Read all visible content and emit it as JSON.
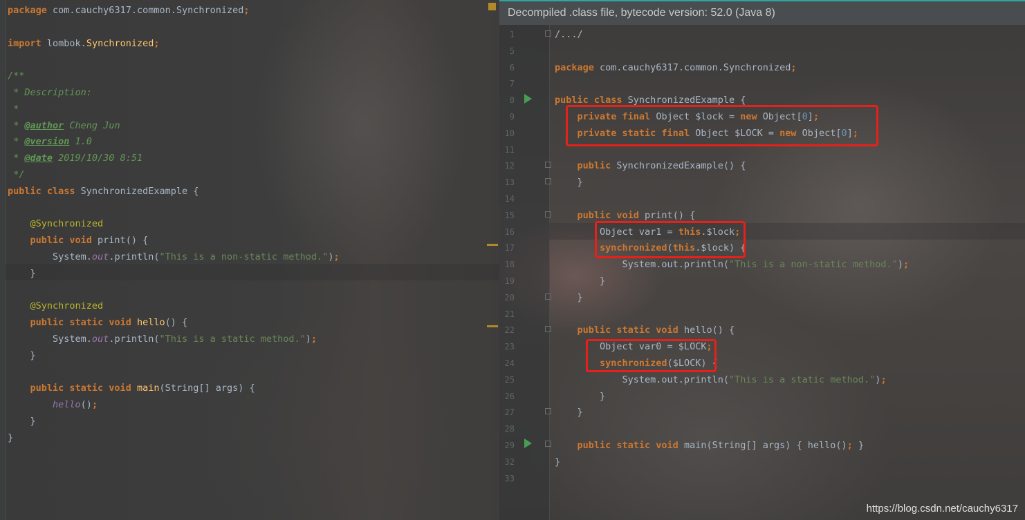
{
  "left_editor": {
    "lines": [
      {
        "parts": [
          [
            "kw",
            "package"
          ],
          [
            "plain",
            " com.cauchy6317.common.Synchronized"
          ],
          [
            "kw",
            ";"
          ]
        ]
      },
      {
        "parts": []
      },
      {
        "parts": [
          [
            "kw",
            "import"
          ],
          [
            "plain",
            " lombok."
          ],
          [
            "fn",
            "Synchronized"
          ],
          [
            "kw",
            ";"
          ]
        ]
      },
      {
        "parts": []
      },
      {
        "parts": [
          [
            "cmt",
            "/**"
          ]
        ]
      },
      {
        "parts": [
          [
            "cmt",
            " * Description:"
          ]
        ]
      },
      {
        "parts": [
          [
            "cmt",
            " *"
          ]
        ]
      },
      {
        "parts": [
          [
            "cmt",
            " * "
          ],
          [
            "tag",
            "@author"
          ],
          [
            "cmt",
            " Cheng Jun"
          ]
        ]
      },
      {
        "parts": [
          [
            "cmt",
            " * "
          ],
          [
            "tag",
            "@version"
          ],
          [
            "cmt",
            " 1.0"
          ]
        ]
      },
      {
        "parts": [
          [
            "cmt",
            " * "
          ],
          [
            "tag",
            "@date"
          ],
          [
            "cmt",
            " 2019/10/30 8:51"
          ]
        ]
      },
      {
        "parts": [
          [
            "cmt",
            " */"
          ]
        ]
      },
      {
        "parts": [
          [
            "kw",
            "public class"
          ],
          [
            "plain",
            " SynchronizedExample {"
          ]
        ]
      },
      {
        "parts": []
      },
      {
        "parts": [
          [
            "plain",
            "    "
          ],
          [
            "ann",
            "@Synchronized"
          ]
        ]
      },
      {
        "parts": [
          [
            "plain",
            "    "
          ],
          [
            "kw",
            "public void"
          ],
          [
            "plain",
            " print() {"
          ]
        ]
      },
      {
        "parts": [
          [
            "plain",
            "        System."
          ],
          [
            "it",
            "out"
          ],
          [
            "plain",
            ".println("
          ],
          [
            "str",
            "\"This is a non-static method.\""
          ],
          [
            "plain",
            ")"
          ],
          [
            "kw",
            ";"
          ]
        ]
      },
      {
        "parts": [
          [
            "plain",
            "    }"
          ]
        ]
      },
      {
        "parts": []
      },
      {
        "parts": [
          [
            "plain",
            "    "
          ],
          [
            "ann",
            "@Synchronized"
          ]
        ]
      },
      {
        "parts": [
          [
            "plain",
            "    "
          ],
          [
            "kw",
            "public"
          ],
          [
            "kw",
            " static void "
          ],
          [
            "fn",
            "hello"
          ],
          [
            "plain",
            "() {"
          ]
        ]
      },
      {
        "parts": [
          [
            "plain",
            "        System."
          ],
          [
            "it",
            "out"
          ],
          [
            "plain",
            ".println("
          ],
          [
            "str",
            "\"This is a static method.\""
          ],
          [
            "plain",
            ")"
          ],
          [
            "kw",
            ";"
          ]
        ]
      },
      {
        "parts": [
          [
            "plain",
            "    }"
          ]
        ]
      },
      {
        "parts": []
      },
      {
        "parts": [
          [
            "plain",
            "    "
          ],
          [
            "kw",
            "public static void"
          ],
          [
            "plain",
            " "
          ],
          [
            "fn",
            "main"
          ],
          [
            "plain",
            "(String[] args) {"
          ]
        ]
      },
      {
        "parts": [
          [
            "plain",
            "        "
          ],
          [
            "it",
            "hello"
          ],
          [
            "plain",
            "()"
          ],
          [
            "kw",
            ";"
          ]
        ]
      },
      {
        "parts": [
          [
            "plain",
            "    }"
          ]
        ]
      },
      {
        "parts": [
          [
            "plain",
            "}"
          ]
        ]
      }
    ]
  },
  "right_editor": {
    "banner": "Decompiled .class file, bytecode version: 52.0 (Java 8)",
    "lines": [
      {
        "num": "1",
        "parts": [
          [
            "plain",
            "/.../"
          ]
        ]
      },
      {
        "num": "5",
        "parts": []
      },
      {
        "num": "6",
        "parts": [
          [
            "kw",
            "package"
          ],
          [
            "plain",
            " com.cauchy6317.common.Synchronized"
          ],
          [
            "kw",
            ";"
          ]
        ]
      },
      {
        "num": "7",
        "parts": []
      },
      {
        "num": "8",
        "parts": [
          [
            "kw",
            "public class"
          ],
          [
            "plain",
            " SynchronizedExample {"
          ]
        ]
      },
      {
        "num": "9",
        "parts": [
          [
            "plain",
            "    "
          ],
          [
            "kw",
            "private final"
          ],
          [
            "plain",
            " Object $lock = "
          ],
          [
            "kw",
            "new"
          ],
          [
            "plain",
            " Object["
          ],
          [
            "num",
            "0"
          ],
          [
            "plain",
            "]"
          ],
          [
            "kw",
            ";"
          ]
        ]
      },
      {
        "num": "10",
        "parts": [
          [
            "plain",
            "    "
          ],
          [
            "kw",
            "private static final"
          ],
          [
            "plain",
            " Object $LOCK = "
          ],
          [
            "kw",
            "new"
          ],
          [
            "plain",
            " Object["
          ],
          [
            "num",
            "0"
          ],
          [
            "plain",
            "]"
          ],
          [
            "kw",
            ";"
          ]
        ]
      },
      {
        "num": "11",
        "parts": []
      },
      {
        "num": "12",
        "parts": [
          [
            "plain",
            "    "
          ],
          [
            "kw",
            "public"
          ],
          [
            "plain",
            " SynchronizedExample() {"
          ]
        ]
      },
      {
        "num": "13",
        "parts": [
          [
            "plain",
            "    }"
          ]
        ]
      },
      {
        "num": "14",
        "parts": []
      },
      {
        "num": "15",
        "parts": [
          [
            "plain",
            "    "
          ],
          [
            "kw",
            "public void"
          ],
          [
            "plain",
            " print() {"
          ]
        ]
      },
      {
        "num": "16",
        "parts": [
          [
            "plain",
            "        Object var1 = "
          ],
          [
            "kw",
            "this"
          ],
          [
            "plain",
            ".$lock"
          ],
          [
            "kw",
            ";"
          ]
        ]
      },
      {
        "num": "17",
        "parts": [
          [
            "plain",
            "        "
          ],
          [
            "kw",
            "synchronized"
          ],
          [
            "plain",
            "("
          ],
          [
            "kw",
            "this"
          ],
          [
            "plain",
            ".$lock) {"
          ]
        ]
      },
      {
        "num": "18",
        "parts": [
          [
            "plain",
            "            System.out.println("
          ],
          [
            "str",
            "\"This is a non-static method.\""
          ],
          [
            "plain",
            ")"
          ],
          [
            "kw",
            ";"
          ]
        ]
      },
      {
        "num": "19",
        "parts": [
          [
            "plain",
            "        }"
          ]
        ]
      },
      {
        "num": "20",
        "parts": [
          [
            "plain",
            "    }"
          ]
        ]
      },
      {
        "num": "21",
        "parts": []
      },
      {
        "num": "22",
        "parts": [
          [
            "plain",
            "    "
          ],
          [
            "kw",
            "public static void"
          ],
          [
            "plain",
            " hello() {"
          ]
        ]
      },
      {
        "num": "23",
        "parts": [
          [
            "plain",
            "        Object var0 = $LOCK"
          ],
          [
            "kw",
            ";"
          ]
        ]
      },
      {
        "num": "24",
        "parts": [
          [
            "plain",
            "        "
          ],
          [
            "kw",
            "synchronized"
          ],
          [
            "plain",
            "($LOCK) {"
          ]
        ]
      },
      {
        "num": "25",
        "parts": [
          [
            "plain",
            "            System.out.println("
          ],
          [
            "str",
            "\"This is a static method.\""
          ],
          [
            "plain",
            ")"
          ],
          [
            "kw",
            ";"
          ]
        ]
      },
      {
        "num": "26",
        "parts": [
          [
            "plain",
            "        }"
          ]
        ]
      },
      {
        "num": "27",
        "parts": [
          [
            "plain",
            "    }"
          ]
        ]
      },
      {
        "num": "28",
        "parts": []
      },
      {
        "num": "29",
        "parts": [
          [
            "plain",
            "    "
          ],
          [
            "kw",
            "public static void"
          ],
          [
            "plain",
            " main(String[] args) { hello()"
          ],
          [
            "kw",
            ";"
          ],
          [
            "plain",
            " }"
          ]
        ]
      },
      {
        "num": "32",
        "parts": [
          [
            "plain",
            "}"
          ]
        ]
      },
      {
        "num": "33",
        "parts": []
      }
    ]
  },
  "watermark": "https://blog.csdn.net/cauchy6317",
  "colors": {
    "keyword": "#cc7832",
    "text": "#a9b7c6",
    "string": "#6a8759",
    "comment": "#629755",
    "annotation": "#bbb529",
    "function": "#ffc66d",
    "highlight_box": "#e8201a"
  }
}
